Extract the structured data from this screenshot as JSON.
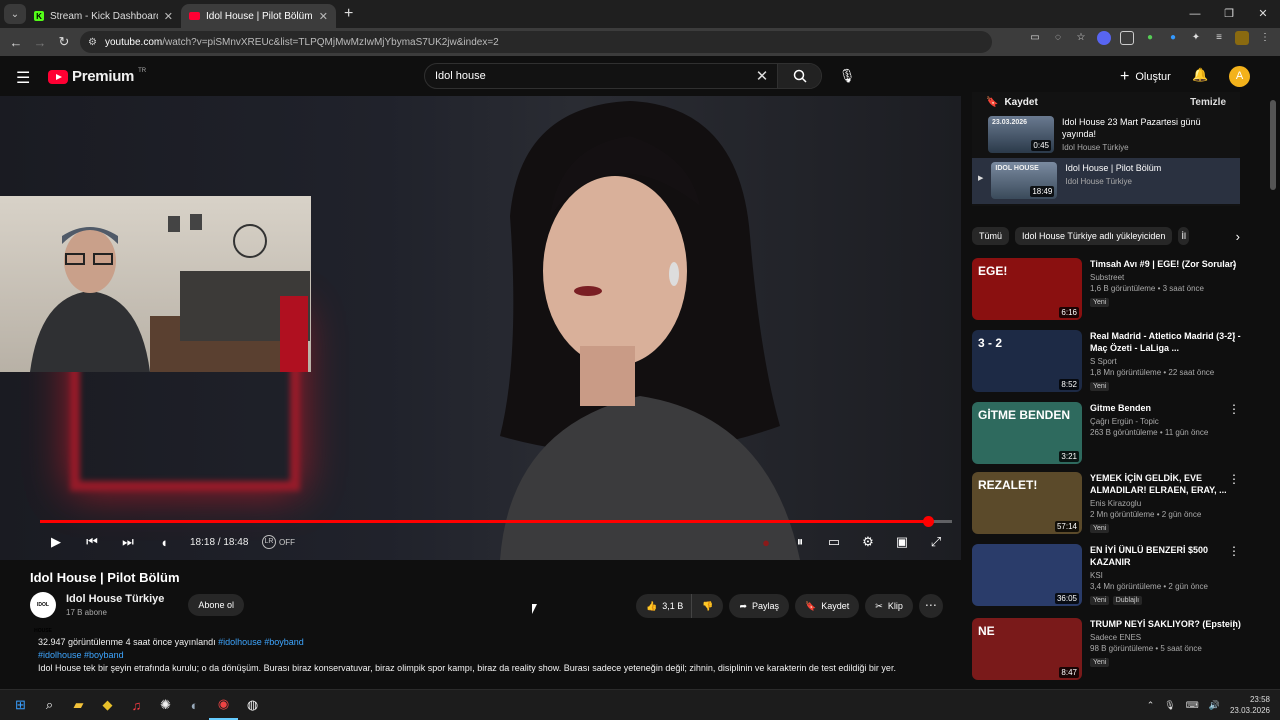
{
  "browser": {
    "tabs": [
      {
        "title": "Stream - Kick Dashboard",
        "active": false
      },
      {
        "title": "Idol House | Pilot Bölüm - YouT",
        "active": true
      }
    ],
    "new_tab": "+",
    "url_host": "youtube.com",
    "url_rest": "/watch?v=piSMnvXREUc&list=TLPQMjMwMzIwMjYbymaS7UK2jw&index=2"
  },
  "youtube": {
    "logo": "Premium",
    "logo_sup": "TR",
    "search_value": "Idol house",
    "create_label": "Oluştur",
    "avatar_letter": "A"
  },
  "player": {
    "time": "18:18 / 18:48",
    "progress": 0.974,
    "lr_state": "OFF",
    "accent": "#ff0000"
  },
  "video": {
    "title": "Idol House | Pilot Bölüm",
    "channel": "Idol House Türkiye",
    "channel_logo_text": "IDOL HOUSE",
    "subscribers": "17 B abone",
    "subscribe_label": "Abone ol",
    "likes": "3,1 B",
    "share_label": "Paylaş",
    "save_label": "Kaydet",
    "clip_label": "Klip",
    "desc_views": "32.947 görüntülenme  4 saat önce yayınlandı",
    "desc_tags_inline": "#idolhouse #boyband",
    "desc_tags_line": "#idolhouse #boyband",
    "desc_text": "Idol House tek bir şeyin etrafında kurulu; o da dönüşüm. Burası biraz konservatuvar, biraz olimpik spor kampı, biraz da reality show. Burası sadece yeteneğin değil; zihnin, disiplinin ve karakterin de test edildiği bir yer."
  },
  "playlist": {
    "save_label": "Kaydet",
    "clear_label": "Temizle",
    "items": [
      {
        "title": "Idol House 23 Mart Pazartesi günü yayında!",
        "channel": "Idol House Türkiye",
        "duration": "0:45",
        "thumb_text": "23.03.2026"
      },
      {
        "title": "Idol House | Pilot Bölüm",
        "channel": "Idol House Türkiye",
        "duration": "18:49",
        "thumb_text": "IDOL HOUSE"
      }
    ]
  },
  "chips": [
    "Tümü",
    "Idol House Türkiye adlı yükleyiciden",
    "İl"
  ],
  "recommendations": [
    {
      "title": "Timsah Avı #9 | EGE! (Zor Sorular)",
      "channel": "Substreet",
      "views": "1,6 B görüntüleme • 3 saat önce",
      "new": "Yeni",
      "duration": "6:16",
      "thumb_text": "EGE!",
      "thumb_color": "#8a1010"
    },
    {
      "title": "Real Madrid - Atletico Madrid (3-2) - Maç Özeti - LaLiga ...",
      "channel": "S Sport",
      "views": "1,8 Mn görüntüleme • 22 saat önce",
      "new": "Yeni",
      "duration": "8:52",
      "thumb_text": "3 - 2",
      "thumb_color": "#1d2a45"
    },
    {
      "title": "Gitme Benden",
      "channel": "Çağrı Ergün - Topic",
      "views": "263 B görüntüleme • 11 gün önce",
      "new": "",
      "duration": "3:21",
      "thumb_text": "GİTME BENDEN",
      "thumb_color": "#2e6a5e"
    },
    {
      "title": "YEMEK İÇİN GELDİK, EVE ALMADILAR! ELRAEN, ERAY, ...",
      "channel": "Enis Kirazoglu",
      "views": "2 Mn görüntüleme • 2 gün önce",
      "new": "Yeni",
      "duration": "57:14",
      "thumb_text": "REZALET!",
      "thumb_color": "#5b4a2a"
    },
    {
      "title": "EN İYİ ÜNLÜ BENZERİ $500 KAZANIR",
      "channel": "KSI",
      "views": "3,4 Mn görüntüleme • 2 gün önce",
      "new": "Yeni",
      "dubbed": "Dublajlı",
      "duration": "36:05",
      "thumb_text": "",
      "thumb_color": "#2a3c6a"
    },
    {
      "title": "TRUMP NEYİ SAKLIYOR? (Epstein)",
      "channel": "Sadece ENES",
      "views": "98 B görüntüleme • 5 saat önce",
      "new": "Yeni",
      "duration": "8:47",
      "thumb_text": "NE",
      "thumb_color": "#7a1a1a"
    }
  ],
  "taskbar": {
    "time": "23:58",
    "date": "23.03.2026"
  }
}
